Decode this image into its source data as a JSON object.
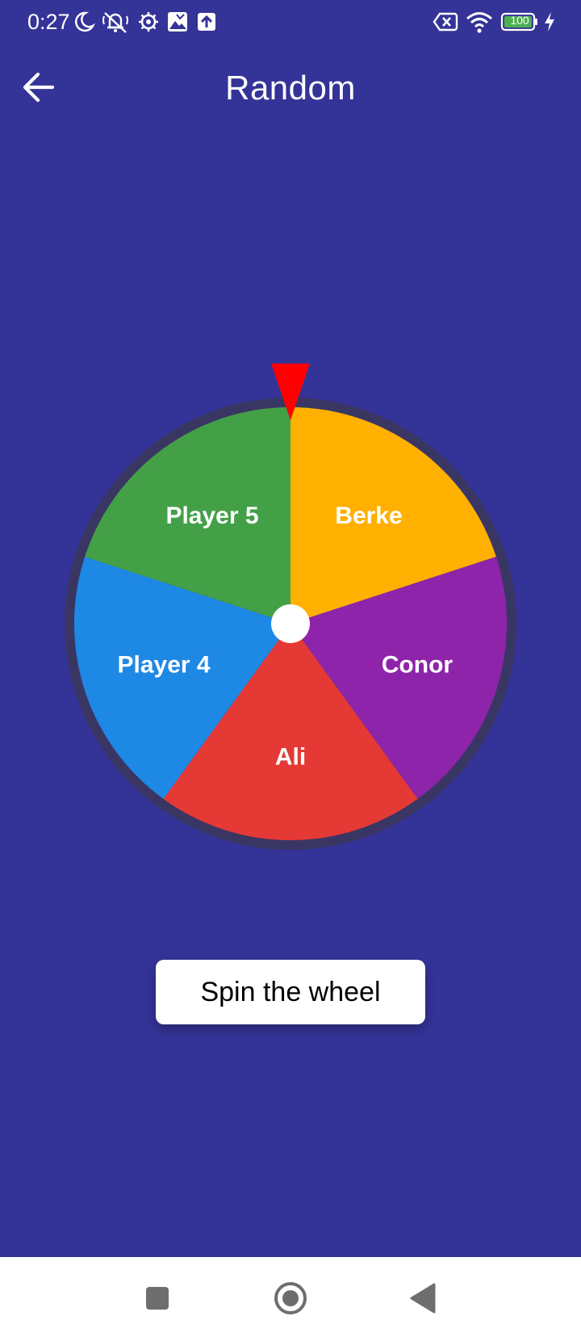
{
  "status_bar": {
    "time": "0:27",
    "battery_level": "100",
    "left_icons": [
      "moon-icon",
      "silent-bell-icon",
      "settings-icon",
      "gallery-icon",
      "upload-icon"
    ],
    "right_icons": [
      "no-sim-icon",
      "wifi-icon",
      "battery-icon",
      "charging-icon"
    ]
  },
  "app_bar": {
    "title": "Random",
    "back_icon": "arrow-left-icon"
  },
  "wheel": {
    "segments": [
      {
        "label": "Berke",
        "color": "#FFB000"
      },
      {
        "label": "Conor",
        "color": "#8E24AA"
      },
      {
        "label": "Ali",
        "color": "#E53935"
      },
      {
        "label": "Player 4",
        "color": "#1E88E5"
      },
      {
        "label": "Player 5",
        "color": "#43A047"
      }
    ],
    "rim_color": "#3A3663",
    "pointer_color": "#FF0000",
    "hub_color": "#FFFFFF"
  },
  "spin_button": {
    "label": "Spin the wheel"
  },
  "nav_bar": {
    "buttons": [
      "recents-square-icon",
      "home-circle-icon",
      "back-triangle-icon"
    ]
  },
  "colors": {
    "background": "#343398",
    "nav_background": "#FFFFFF"
  }
}
